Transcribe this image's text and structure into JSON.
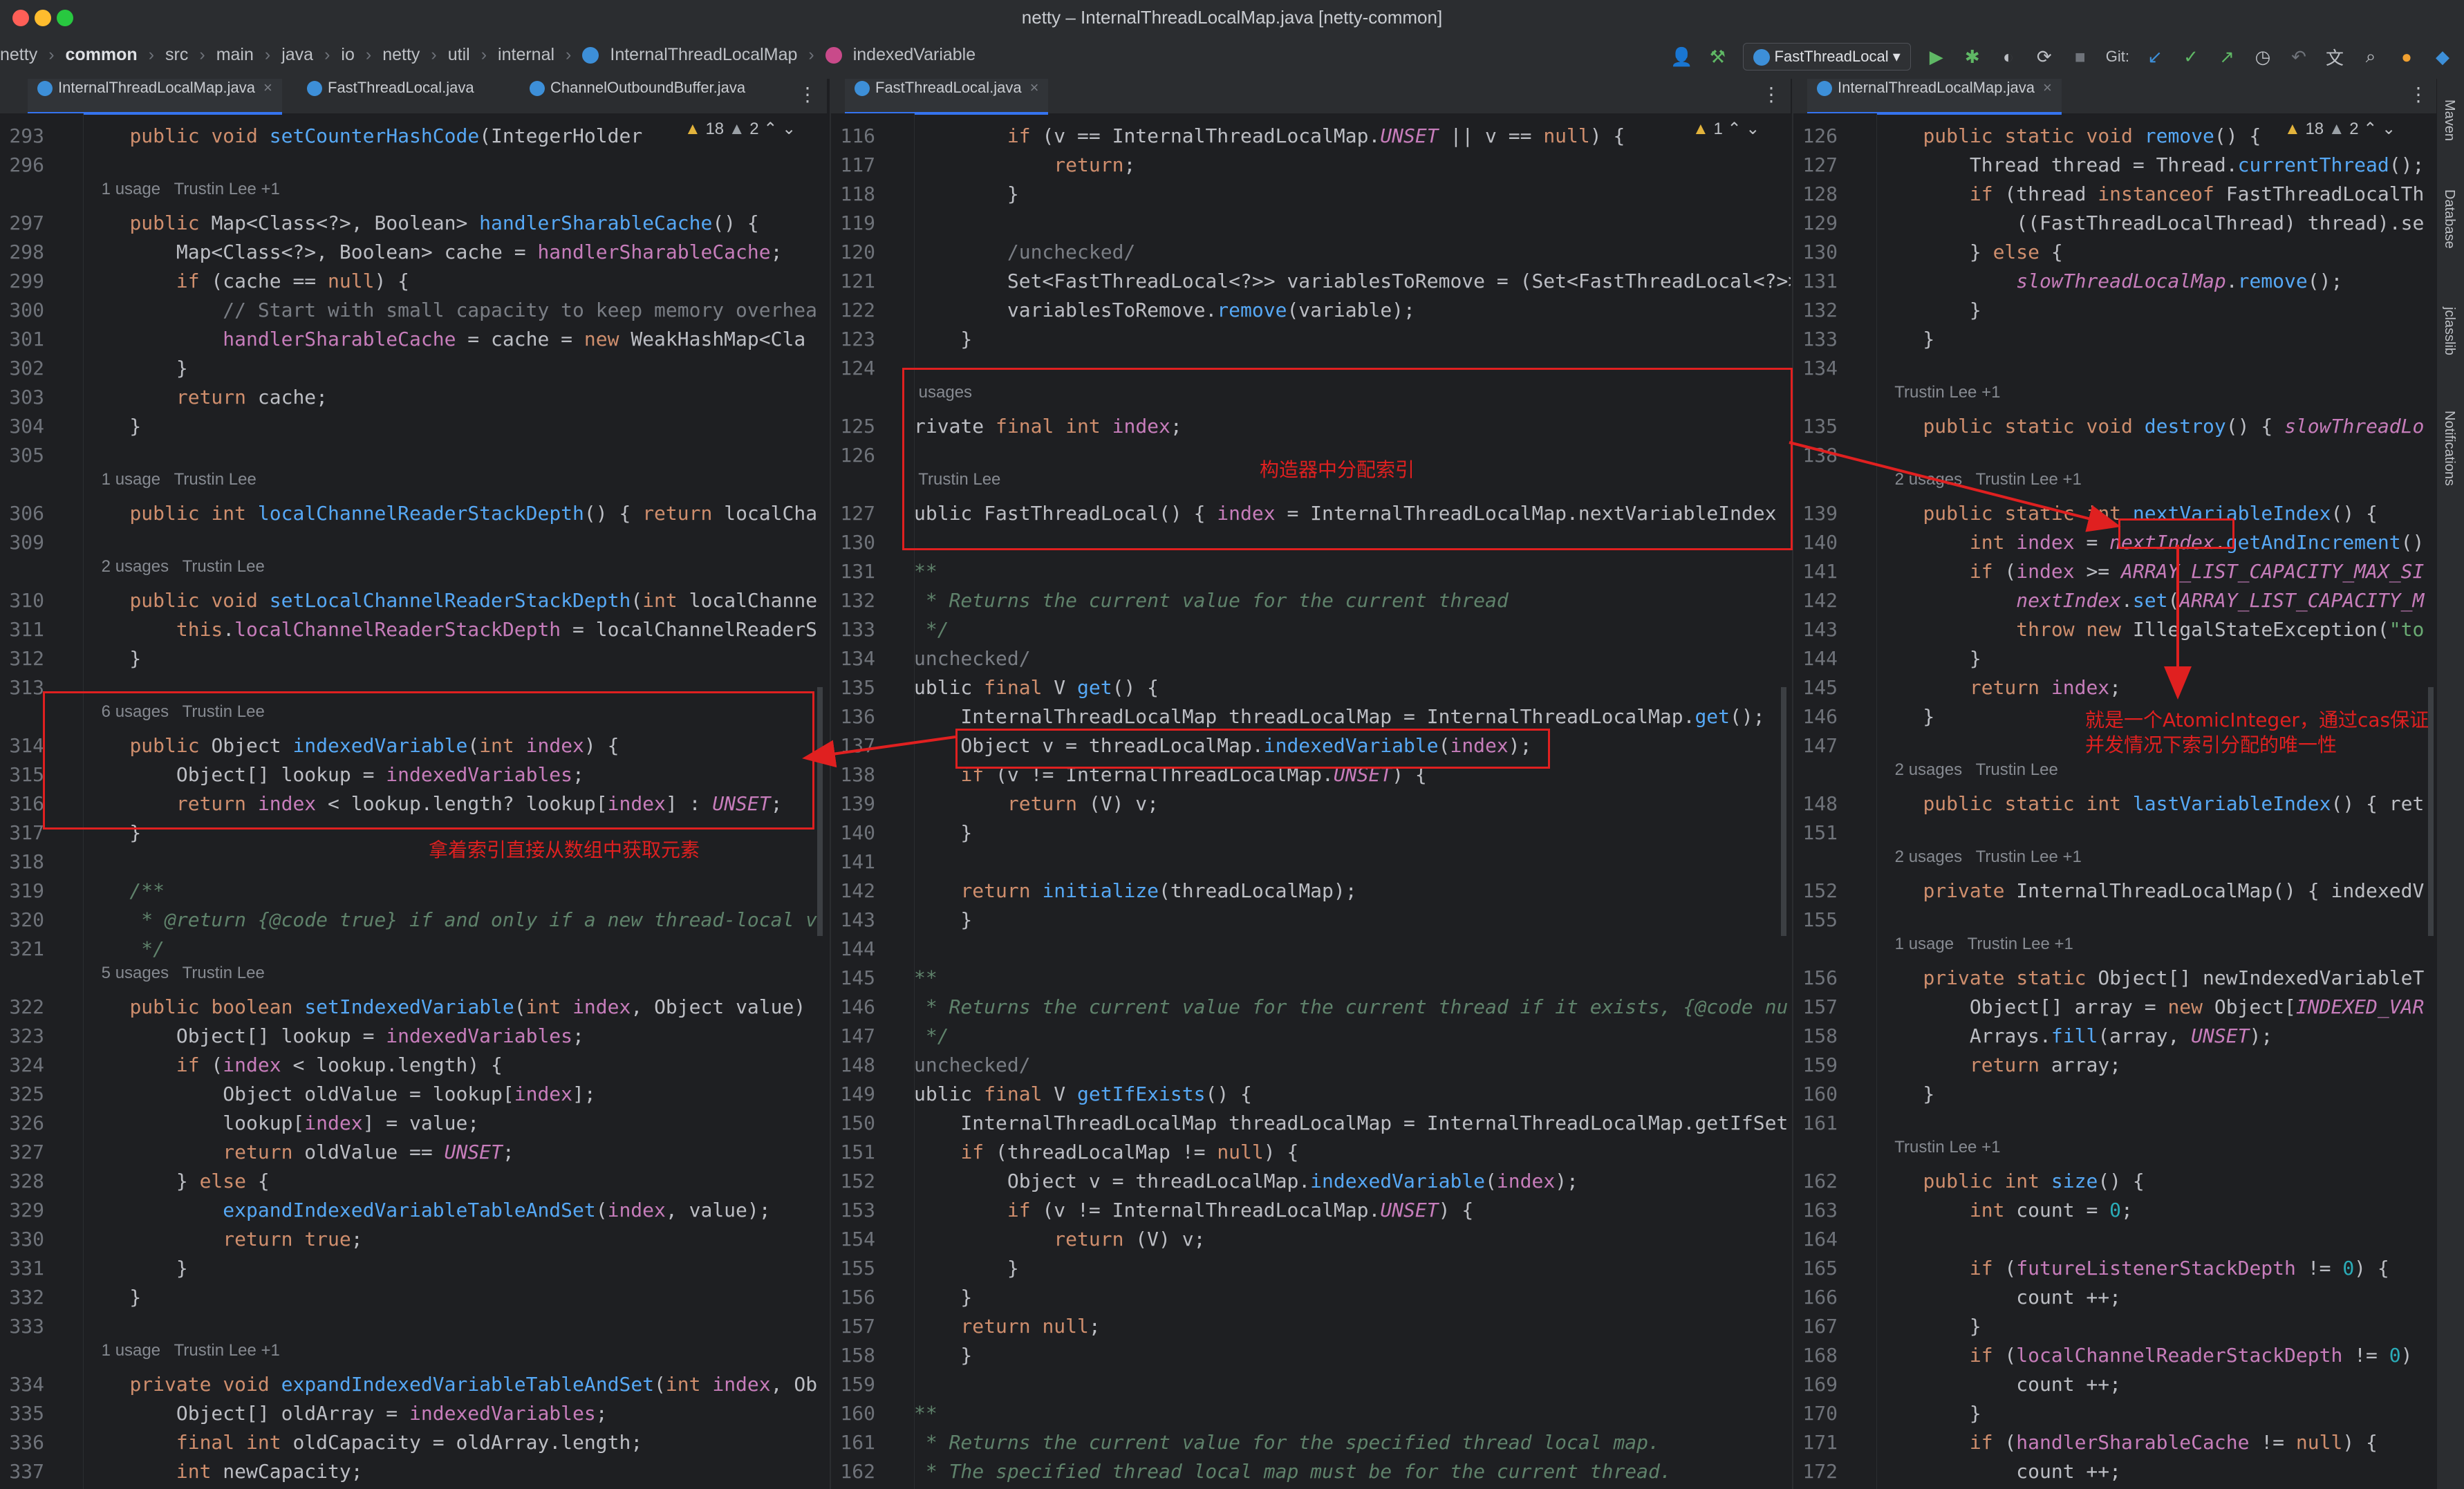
{
  "window": {
    "title": "netty – InternalThreadLocalMap.java [netty-common]"
  },
  "breadcrumb": [
    "netty",
    "common",
    "src",
    "main",
    "java",
    "io",
    "netty",
    "util",
    "internal",
    "InternalThreadLocalMap",
    "indexedVariable"
  ],
  "toolbar": {
    "run_config": "FastThreadLocal",
    "git_label": "Git:"
  },
  "right_strip": [
    "Maven",
    "Database",
    "jclasslib",
    "Notifications"
  ],
  "panes": [
    {
      "id": "left",
      "tabs": [
        {
          "label": "InternalThreadLocalMap.java",
          "active": true
        },
        {
          "label": "FastThreadLocal.java",
          "active": false
        },
        {
          "label": "ChannelOutboundBuffer.java",
          "active": false
        }
      ],
      "warnings": {
        "warn_count": "18",
        "weak_count": "2"
      },
      "lines": [
        {
          "n": "293",
          "t": "    public void setCounterHashCode(IntegerHolder"
        },
        {
          "n": "296",
          "t": ""
        },
        {
          "n": "",
          "t": "    1 usage   Trustin Lee +1",
          "hint": true
        },
        {
          "n": "297",
          "t": "    public Map<Class<?>, Boolean> handlerSharableCache() {"
        },
        {
          "n": "298",
          "t": "        Map<Class<?>, Boolean> cache = handlerSharableCache;"
        },
        {
          "n": "299",
          "t": "        if (cache == null) {"
        },
        {
          "n": "300",
          "t": "            // Start with small capacity to keep memory overhea"
        },
        {
          "n": "301",
          "t": "            handlerSharableCache = cache = new WeakHashMap<Cla"
        },
        {
          "n": "302",
          "t": "        }"
        },
        {
          "n": "303",
          "t": "        return cache;"
        },
        {
          "n": "304",
          "t": "    }"
        },
        {
          "n": "305",
          "t": ""
        },
        {
          "n": "",
          "t": "    1 usage   Trustin Lee",
          "hint": true
        },
        {
          "n": "306",
          "t": "    public int localChannelReaderStackDepth() { return localCha"
        },
        {
          "n": "309",
          "t": ""
        },
        {
          "n": "",
          "t": "    2 usages   Trustin Lee",
          "hint": true
        },
        {
          "n": "310",
          "t": "    public void setLocalChannelReaderStackDepth(int localChanne"
        },
        {
          "n": "311",
          "t": "        this.localChannelReaderStackDepth = localChannelReaderS"
        },
        {
          "n": "312",
          "t": "    }"
        },
        {
          "n": "313",
          "t": ""
        },
        {
          "n": "",
          "t": "    6 usages   Trustin Lee",
          "hint": true
        },
        {
          "n": "314",
          "t": "    public Object indexedVariable(int index) {"
        },
        {
          "n": "315",
          "t": "        Object[] lookup = indexedVariables;"
        },
        {
          "n": "316",
          "t": "        return index < lookup.length? lookup[index] : UNSET;"
        },
        {
          "n": "317",
          "t": "    }"
        },
        {
          "n": "318",
          "t": ""
        },
        {
          "n": "319",
          "t": "    /**"
        },
        {
          "n": "320",
          "t": "     * @return {@code true} if and only if a new thread-local v"
        },
        {
          "n": "321",
          "t": "     */"
        },
        {
          "n": "",
          "t": "    5 usages   Trustin Lee",
          "hint": true
        },
        {
          "n": "322",
          "t": "    public boolean setIndexedVariable(int index, Object value)"
        },
        {
          "n": "323",
          "t": "        Object[] lookup = indexedVariables;"
        },
        {
          "n": "324",
          "t": "        if (index < lookup.length) {"
        },
        {
          "n": "325",
          "t": "            Object oldValue = lookup[index];"
        },
        {
          "n": "326",
          "t": "            lookup[index] = value;"
        },
        {
          "n": "327",
          "t": "            return oldValue == UNSET;"
        },
        {
          "n": "328",
          "t": "        } else {"
        },
        {
          "n": "329",
          "t": "            expandIndexedVariableTableAndSet(index, value);"
        },
        {
          "n": "330",
          "t": "            return true;"
        },
        {
          "n": "331",
          "t": "        }"
        },
        {
          "n": "332",
          "t": "    }"
        },
        {
          "n": "333",
          "t": ""
        },
        {
          "n": "",
          "t": "    1 usage   Trustin Lee +1",
          "hint": true
        },
        {
          "n": "334",
          "t": "    private void expandIndexedVariableTableAndSet(int index, Ob"
        },
        {
          "n": "335",
          "t": "        Object[] oldArray = indexedVariables;"
        },
        {
          "n": "336",
          "t": "        final int oldCapacity = oldArray.length;"
        },
        {
          "n": "337",
          "t": "        int newCapacity;"
        },
        {
          "n": "338",
          "t": "        if (index >= ARRAY_LIST_CAPACITY_EXPAND_THRESHOLD) {"
        }
      ]
    },
    {
      "id": "middle",
      "tabs": [
        {
          "label": "FastThreadLocal.java",
          "active": true
        }
      ],
      "warnings": {
        "warn_count": "1"
      },
      "lines": [
        {
          "n": "116",
          "t": "        if (v == InternalThreadLocalMap.UNSET || v == null) {"
        },
        {
          "n": "117",
          "t": "            return;"
        },
        {
          "n": "118",
          "t": "        }"
        },
        {
          "n": "119",
          "t": ""
        },
        {
          "n": "120",
          "t": "        /unchecked/"
        },
        {
          "n": "121",
          "t": "        Set<FastThreadLocal<?>> variablesToRemove = (Set<FastThreadLocal<?>>) v"
        },
        {
          "n": "122",
          "t": "        variablesToRemove.remove(variable);"
        },
        {
          "n": "123",
          "t": "    }"
        },
        {
          "n": "124",
          "t": ""
        },
        {
          "n": "",
          "t": " usages",
          "hint": true
        },
        {
          "n": "125",
          "t": "rivate final int index;"
        },
        {
          "n": "126",
          "t": ""
        },
        {
          "n": "",
          "t": " Trustin Lee",
          "hint": true
        },
        {
          "n": "127",
          "t": "ublic FastThreadLocal() { index = InternalThreadLocalMap.nextVariableIndex"
        },
        {
          "n": "130",
          "t": ""
        },
        {
          "n": "131",
          "t": "**"
        },
        {
          "n": "132",
          "t": " * Returns the current value for the current thread"
        },
        {
          "n": "133",
          "t": " */"
        },
        {
          "n": "134",
          "t": "unchecked/"
        },
        {
          "n": "135",
          "t": "ublic final V get() {"
        },
        {
          "n": "136",
          "t": "    InternalThreadLocalMap threadLocalMap = InternalThreadLocalMap.get();"
        },
        {
          "n": "137",
          "t": "    Object v = threadLocalMap.indexedVariable(index);"
        },
        {
          "n": "138",
          "t": "    if (v != InternalThreadLocalMap.UNSET) {"
        },
        {
          "n": "139",
          "t": "        return (V) v;"
        },
        {
          "n": "140",
          "t": "    }"
        },
        {
          "n": "141",
          "t": ""
        },
        {
          "n": "142",
          "t": "    return initialize(threadLocalMap);"
        },
        {
          "n": "143",
          "t": "    }"
        },
        {
          "n": "144",
          "t": ""
        },
        {
          "n": "145",
          "t": "**"
        },
        {
          "n": "146",
          "t": " * Returns the current value for the current thread if it exists, {@code nu"
        },
        {
          "n": "147",
          "t": " */"
        },
        {
          "n": "148",
          "t": "unchecked/"
        },
        {
          "n": "149",
          "t": "ublic final V getIfExists() {"
        },
        {
          "n": "150",
          "t": "    InternalThreadLocalMap threadLocalMap = InternalThreadLocalMap.getIfSet"
        },
        {
          "n": "151",
          "t": "    if (threadLocalMap != null) {"
        },
        {
          "n": "152",
          "t": "        Object v = threadLocalMap.indexedVariable(index);"
        },
        {
          "n": "153",
          "t": "        if (v != InternalThreadLocalMap.UNSET) {"
        },
        {
          "n": "154",
          "t": "            return (V) v;"
        },
        {
          "n": "155",
          "t": "        }"
        },
        {
          "n": "156",
          "t": "    }"
        },
        {
          "n": "157",
          "t": "    return null;"
        },
        {
          "n": "158",
          "t": "    }"
        },
        {
          "n": "159",
          "t": ""
        },
        {
          "n": "160",
          "t": "**"
        },
        {
          "n": "161",
          "t": " * Returns the current value for the specified thread local map."
        },
        {
          "n": "162",
          "t": " * The specified thread local map must be for the current thread."
        }
      ]
    },
    {
      "id": "right",
      "tabs": [
        {
          "label": "InternalThreadLocalMap.java",
          "active": true
        }
      ],
      "warnings": {
        "warn_count": "18",
        "weak_count": "2"
      },
      "lines": [
        {
          "n": "126",
          "t": "    public static void remove() {"
        },
        {
          "n": "127",
          "t": "        Thread thread = Thread.currentThread();"
        },
        {
          "n": "128",
          "t": "        if (thread instanceof FastThreadLocalTh"
        },
        {
          "n": "129",
          "t": "            ((FastThreadLocalThread) thread).se"
        },
        {
          "n": "130",
          "t": "        } else {"
        },
        {
          "n": "131",
          "t": "            slowThreadLocalMap.remove();"
        },
        {
          "n": "132",
          "t": "        }"
        },
        {
          "n": "133",
          "t": "    }"
        },
        {
          "n": "134",
          "t": ""
        },
        {
          "n": "",
          "t": "    Trustin Lee +1",
          "hint": true
        },
        {
          "n": "135",
          "t": "    public static void destroy() { slowThreadLo"
        },
        {
          "n": "138",
          "t": ""
        },
        {
          "n": "",
          "t": "    2 usages   Trustin Lee +1",
          "hint": true
        },
        {
          "n": "139",
          "t": "    public static int nextVariableIndex() {"
        },
        {
          "n": "140",
          "t": "        int index = nextIndex.getAndIncrement()"
        },
        {
          "n": "141",
          "t": "        if (index >= ARRAY_LIST_CAPACITY_MAX_SI"
        },
        {
          "n": "142",
          "t": "            nextIndex.set(ARRAY_LIST_CAPACITY_M"
        },
        {
          "n": "143",
          "t": "            throw new IllegalStateException(\"to"
        },
        {
          "n": "144",
          "t": "        }"
        },
        {
          "n": "145",
          "t": "        return index;"
        },
        {
          "n": "146",
          "t": "    }"
        },
        {
          "n": "147",
          "t": ""
        },
        {
          "n": "",
          "t": "    2 usages   Trustin Lee",
          "hint": true
        },
        {
          "n": "148",
          "t": "    public static int lastVariableIndex() { ret"
        },
        {
          "n": "151",
          "t": ""
        },
        {
          "n": "",
          "t": "    2 usages   Trustin Lee +1",
          "hint": true
        },
        {
          "n": "152",
          "t": "    private InternalThreadLocalMap() { indexedV"
        },
        {
          "n": "155",
          "t": ""
        },
        {
          "n": "",
          "t": "    1 usage   Trustin Lee +1",
          "hint": true
        },
        {
          "n": "156",
          "t": "    private static Object[] newIndexedVariableT"
        },
        {
          "n": "157",
          "t": "        Object[] array = new Object[INDEXED_VAR"
        },
        {
          "n": "158",
          "t": "        Arrays.fill(array, UNSET);"
        },
        {
          "n": "159",
          "t": "        return array;"
        },
        {
          "n": "160",
          "t": "    }"
        },
        {
          "n": "161",
          "t": ""
        },
        {
          "n": "",
          "t": "    Trustin Lee +1",
          "hint": true
        },
        {
          "n": "162",
          "t": "    public int size() {"
        },
        {
          "n": "163",
          "t": "        int count = 0;"
        },
        {
          "n": "164",
          "t": ""
        },
        {
          "n": "165",
          "t": "        if (futureListenerStackDepth != 0) {"
        },
        {
          "n": "166",
          "t": "            count ++;"
        },
        {
          "n": "167",
          "t": "        }"
        },
        {
          "n": "168",
          "t": "        if (localChannelReaderStackDepth != 0)"
        },
        {
          "n": "169",
          "t": "            count ++;"
        },
        {
          "n": "170",
          "t": "        }"
        },
        {
          "n": "171",
          "t": "        if (handlerSharableCache != null) {"
        },
        {
          "n": "172",
          "t": "            count ++;"
        },
        {
          "n": "173",
          "t": "        }"
        }
      ]
    }
  ],
  "annotations": {
    "left_note": "拿着索引直接从数组中获取元素",
    "middle_note": "构造器中分配索引",
    "right_note_1": "就是一个AtomicInteger，通过cas保证",
    "right_note_2": "并发情况下索引分配的唯一性"
  },
  "colors": {
    "annotation_red": "#e02020",
    "keyword": "#cf8e6d",
    "method": "#56a8f5",
    "field": "#c77dbb"
  }
}
